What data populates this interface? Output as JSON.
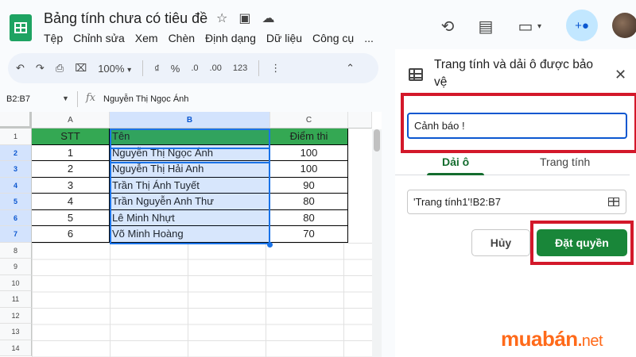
{
  "header": {
    "doc_title": "Bảng tính chưa có tiêu đề",
    "menu": [
      "Tệp",
      "Chỉnh sửa",
      "Xem",
      "Chèn",
      "Định dạng",
      "Dữ liệu",
      "Công cụ",
      "..."
    ]
  },
  "toolbar": {
    "zoom": "100%",
    "currency": "₫",
    "percent": "%",
    "dec_decrease": ".0",
    "dec_increase": ".00",
    "number_format": "123"
  },
  "formula_bar": {
    "name_box": "B2:B7",
    "fx": "fx",
    "content": "Nguyễn Thị Ngọc Ánh"
  },
  "sheet": {
    "columns": [
      "A",
      "B",
      "C"
    ],
    "row_numbers": [
      "1",
      "2",
      "3",
      "4",
      "5",
      "6",
      "7",
      "8",
      "9",
      "10",
      "11",
      "12",
      "13",
      "14"
    ],
    "header_row": [
      "STT",
      "Tên",
      "Điểm thi"
    ],
    "rows": [
      [
        "1",
        "Nguyễn Thị Ngọc Ánh",
        "100"
      ],
      [
        "2",
        "Nguyễn Thị Hải Anh",
        "100"
      ],
      [
        "3",
        "Trần Thị Ánh Tuyết",
        "90"
      ],
      [
        "4",
        "Trần Nguyễn Anh Thư",
        "80"
      ],
      [
        "5",
        "Lê Minh Nhựt",
        "80"
      ],
      [
        "6",
        "Võ Minh Hoàng",
        "70"
      ]
    ],
    "header_color": "#34a853",
    "selection_color": "#1a73e8"
  },
  "panel": {
    "title": "Trang tính và dải ô được bảo vệ",
    "description_value": "Cảnh báo !",
    "tabs": [
      "Dải ô",
      "Trang tính"
    ],
    "active_tab": "Dải ô",
    "range_value": "'Trang tính1'!B2:B7",
    "cancel_label": "Hủy",
    "set_permissions_label": "Đặt quyền",
    "accent_color": "#198639",
    "highlight_color": "#d3182a"
  },
  "watermark": {
    "main": "muabán",
    "dot": ".",
    "net": "net"
  }
}
